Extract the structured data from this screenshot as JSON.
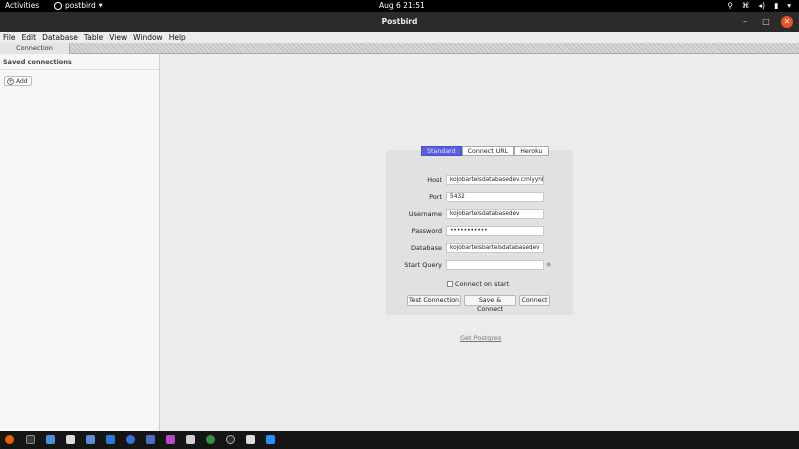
{
  "topbar": {
    "activities": "Activities",
    "app_name": "postbird",
    "clock": "Aug 6  21:51",
    "tray_icons": [
      "accessibility-icon",
      "network-icon",
      "volume-icon",
      "battery-icon",
      "system-menu-icon"
    ]
  },
  "window": {
    "title": "Postbird",
    "controls": [
      "minimize",
      "maximize",
      "close"
    ]
  },
  "menu": [
    "File",
    "Edit",
    "Database",
    "Table",
    "View",
    "Window",
    "Help"
  ],
  "tabs": [
    {
      "label": "Connection"
    }
  ],
  "sidebar": {
    "heading": "Saved connections",
    "add_label": "Add"
  },
  "form": {
    "modes": [
      "Standard",
      "Connect URL",
      "Heroku"
    ],
    "active_mode": "Standard",
    "fields": [
      {
        "label": "Host",
        "value": "kojobartelsdatabasedev.cmlyynbcg"
      },
      {
        "label": "Port",
        "value": "5432"
      },
      {
        "label": "Username",
        "value": "kojobartelsdatabasedev"
      },
      {
        "label": "Password",
        "value": "•••••••••••"
      },
      {
        "label": "Database",
        "value": "kojobartelsbartelsdatabasedev"
      },
      {
        "label": "Start Query",
        "value": ""
      }
    ],
    "connect_on_start_label": "Connect on start",
    "connect_on_start_checked": false,
    "buttons": {
      "test": "Test Connection",
      "save_connect": "Save & Connect",
      "connect": "Connect"
    }
  },
  "get_postgres_link": "Get Postgres",
  "dock_apps": [
    "firefox",
    "terminal",
    "files",
    "screenshot",
    "chrome-remote",
    "vscode",
    "chromium-app",
    "documents",
    "media",
    "tiles",
    "chrome",
    "spotify-style",
    "postbird",
    "zoom"
  ],
  "colors": {
    "accent_tab": "#5a5ee0",
    "close_button": "#e95420",
    "topbar_bg": "#000000"
  }
}
